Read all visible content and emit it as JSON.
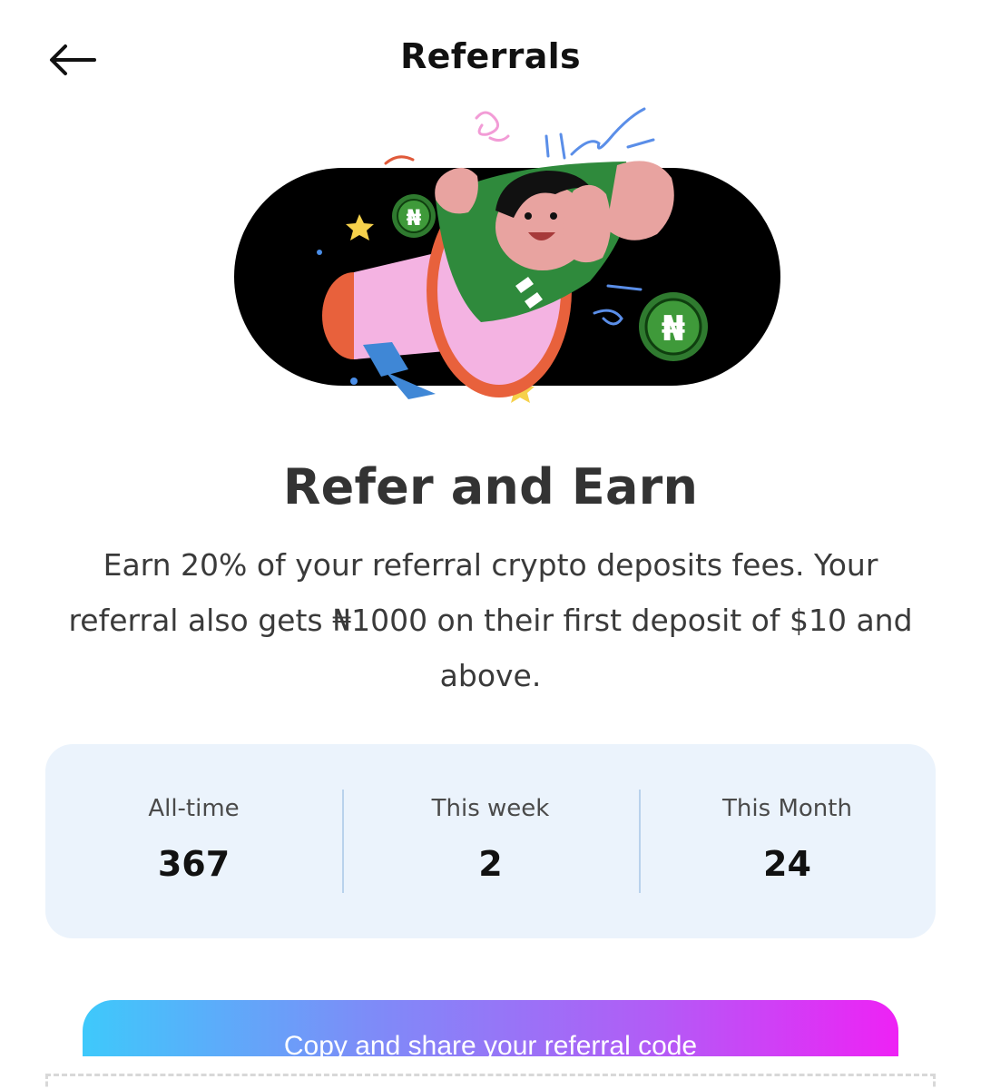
{
  "header": {
    "title": "Referrals",
    "back_icon": "arrow-left-icon"
  },
  "hero": {
    "illustration": "person-with-megaphone-illustration",
    "coin_symbol": "₦"
  },
  "headline": "Refer and Earn",
  "description": "Earn 20% of your referral crypto deposits fees. Your referral also gets ₦1000 on their first deposit of $10 and above.",
  "stats": [
    {
      "label": "All-time",
      "value": "367"
    },
    {
      "label": "This week",
      "value": "2"
    },
    {
      "label": "This Month",
      "value": "24"
    }
  ],
  "cta": {
    "label": "Copy and share your referral code"
  },
  "colors": {
    "stats_bg": "#ebf3fc",
    "gradient_start": "#3ec9fb",
    "gradient_end": "#ee22f5",
    "hero_green": "#2f8a3c",
    "hero_pink": "#f4b3e2"
  }
}
